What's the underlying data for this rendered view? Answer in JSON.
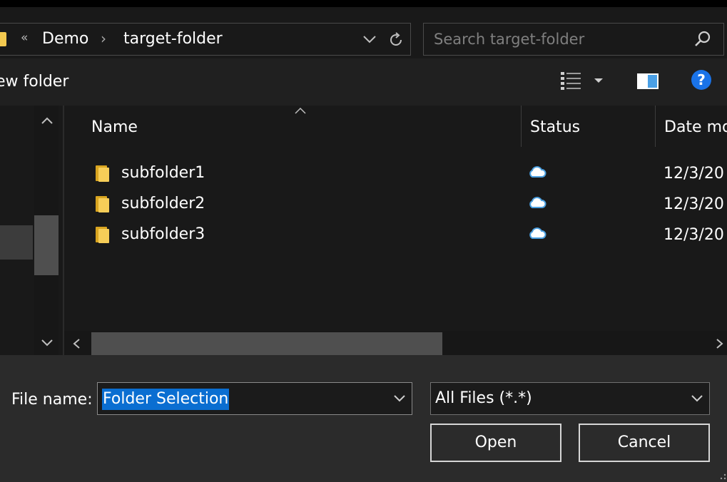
{
  "address": {
    "overflow_chevron": "«",
    "segments": [
      "Demo",
      "target-folder"
    ],
    "separator": "›"
  },
  "search": {
    "placeholder": "Search target-folder"
  },
  "toolbar": {
    "new_folder_label": "ew folder"
  },
  "columns": {
    "name": "Name",
    "status": "Status",
    "date": "Date mo"
  },
  "files": [
    {
      "name": "subfolder1",
      "date": "12/3/20",
      "status_icon": "cloud-icon"
    },
    {
      "name": "subfolder2",
      "date": "12/3/20",
      "status_icon": "cloud-icon"
    },
    {
      "name": "subfolder3",
      "date": "12/3/20",
      "status_icon": "cloud-icon"
    }
  ],
  "bottom": {
    "file_name_label": "File name:",
    "file_name_value": "Folder Selection",
    "file_type_value": "All Files (*.*)",
    "open_label": "Open",
    "cancel_label": "Cancel"
  },
  "colors": {
    "selection": "#0a6ed1",
    "folder": "#f3c94f",
    "cloud": "#4a9fe0",
    "help": "#1a73e8"
  }
}
